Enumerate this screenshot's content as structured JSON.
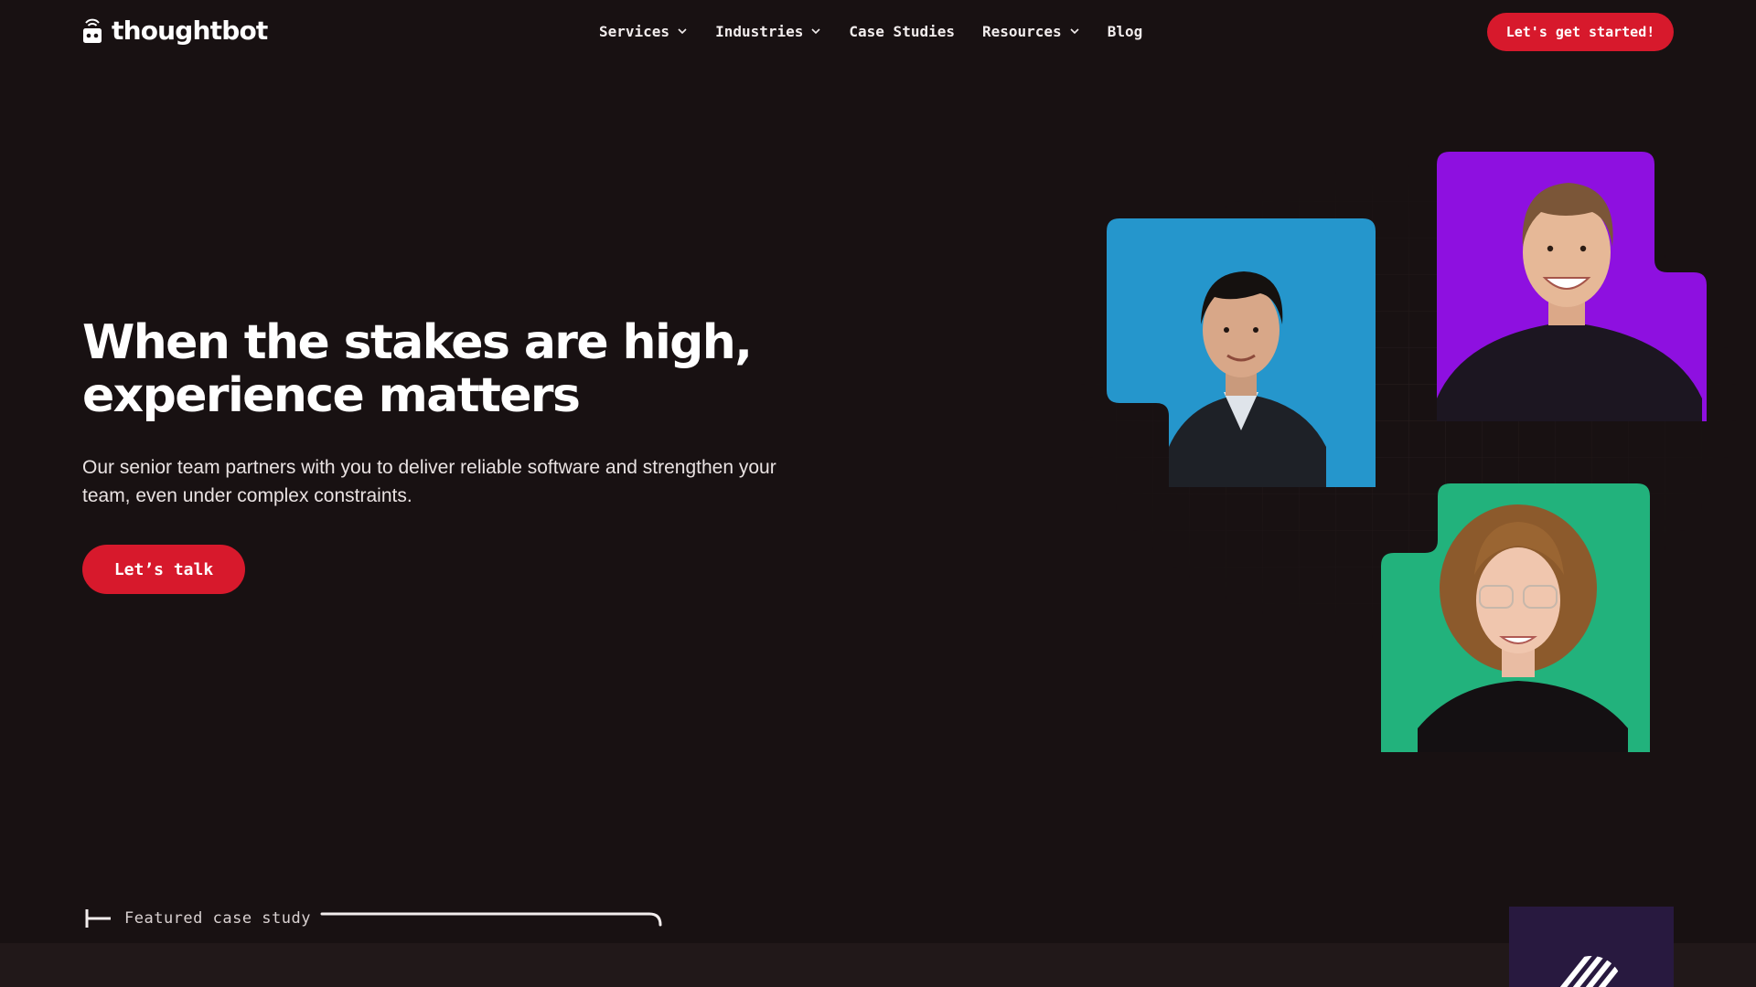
{
  "header": {
    "brand": "thoughtbot",
    "nav": [
      {
        "label": "Services",
        "has_dropdown": true
      },
      {
        "label": "Industries",
        "has_dropdown": true
      },
      {
        "label": "Case Studies",
        "has_dropdown": false
      },
      {
        "label": "Resources",
        "has_dropdown": true
      },
      {
        "label": "Blog",
        "has_dropdown": false
      }
    ],
    "cta_label": "Let's get started!"
  },
  "hero": {
    "title": "When the stakes are high, experience matters",
    "subtitle": "Our senior team partners with you to deliver reliable software and strengthen your team, even under complex constraints.",
    "cta_label": "Let’s talk",
    "photos": [
      {
        "alt": "team member portrait",
        "background": "#2596cc"
      },
      {
        "alt": "team member portrait",
        "background": "#8e10e0"
      },
      {
        "alt": "team member portrait",
        "background": "#22b27c"
      }
    ]
  },
  "featured": {
    "label": "Featured case study"
  },
  "colors": {
    "background": "#181112",
    "accent": "#d7192c",
    "text": "#ffffff",
    "card": "#28193f"
  },
  "icons": [
    "thoughtbot-logo-icon",
    "chevron-down-icon",
    "case-study-logo-icon"
  ]
}
